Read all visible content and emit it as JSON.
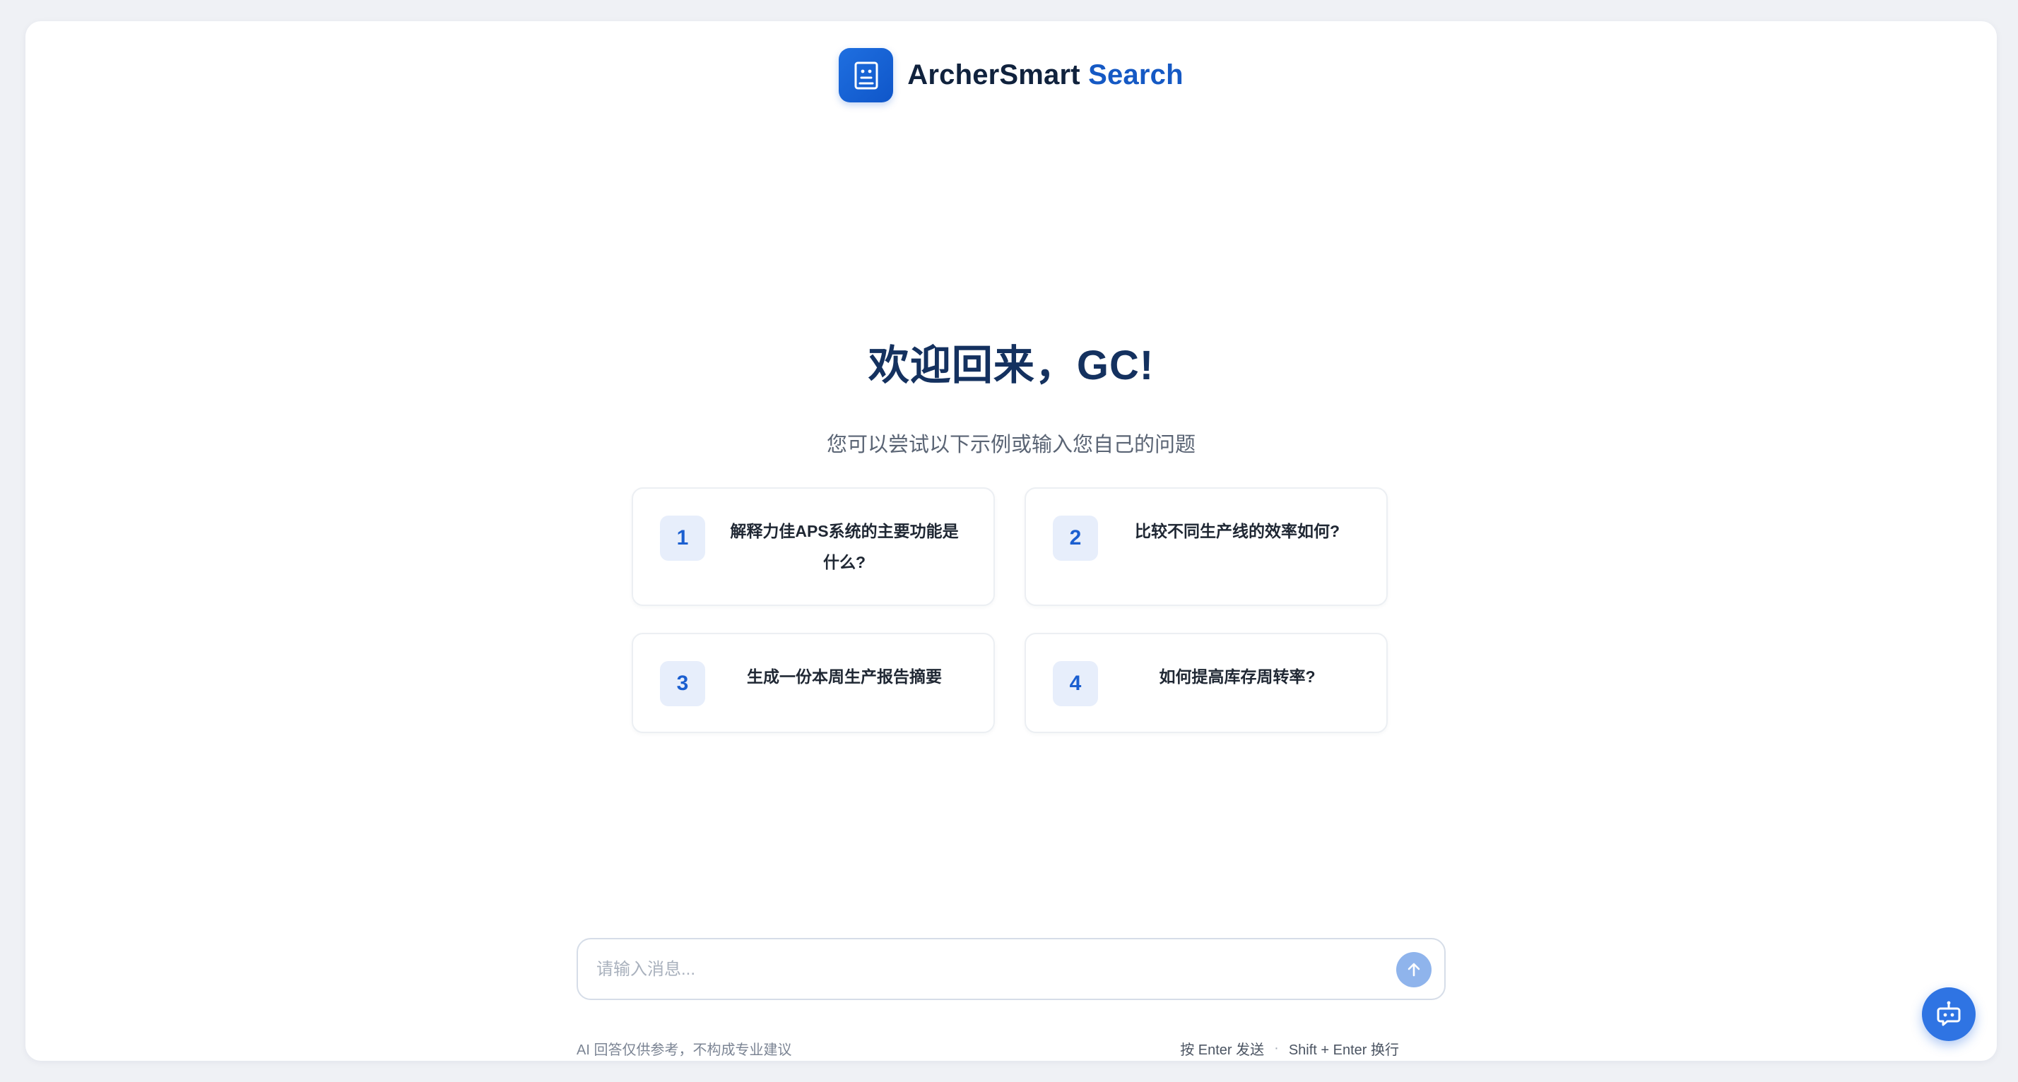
{
  "brand": {
    "name_part1": "ArcherSmart",
    "name_part2": " Search",
    "logo_icon": "document-robot-icon",
    "accent_color": "#1559c4"
  },
  "welcome": {
    "title": "欢迎回来，GC!",
    "subtitle": "您可以尝试以下示例或输入您自己的问题"
  },
  "suggestions": [
    {
      "number": "1",
      "text": "解释力佳APS系统的主要功能是什么?"
    },
    {
      "number": "2",
      "text": "比较不同生产线的效率如何?"
    },
    {
      "number": "3",
      "text": "生成一份本周生产报告摘要"
    },
    {
      "number": "4",
      "text": "如何提高库存周转率?"
    }
  ],
  "input": {
    "placeholder": "请输入消息...",
    "value": "",
    "send_icon": "arrow-up-icon"
  },
  "footer": {
    "disclaimer": "AI 回答仅供参考，不构成专业建议",
    "enter_hint": "按 Enter 发送",
    "separator": "·",
    "shift_enter_hint": "Shift + Enter 换行"
  },
  "fab": {
    "icon": "chat-robot-icon"
  }
}
